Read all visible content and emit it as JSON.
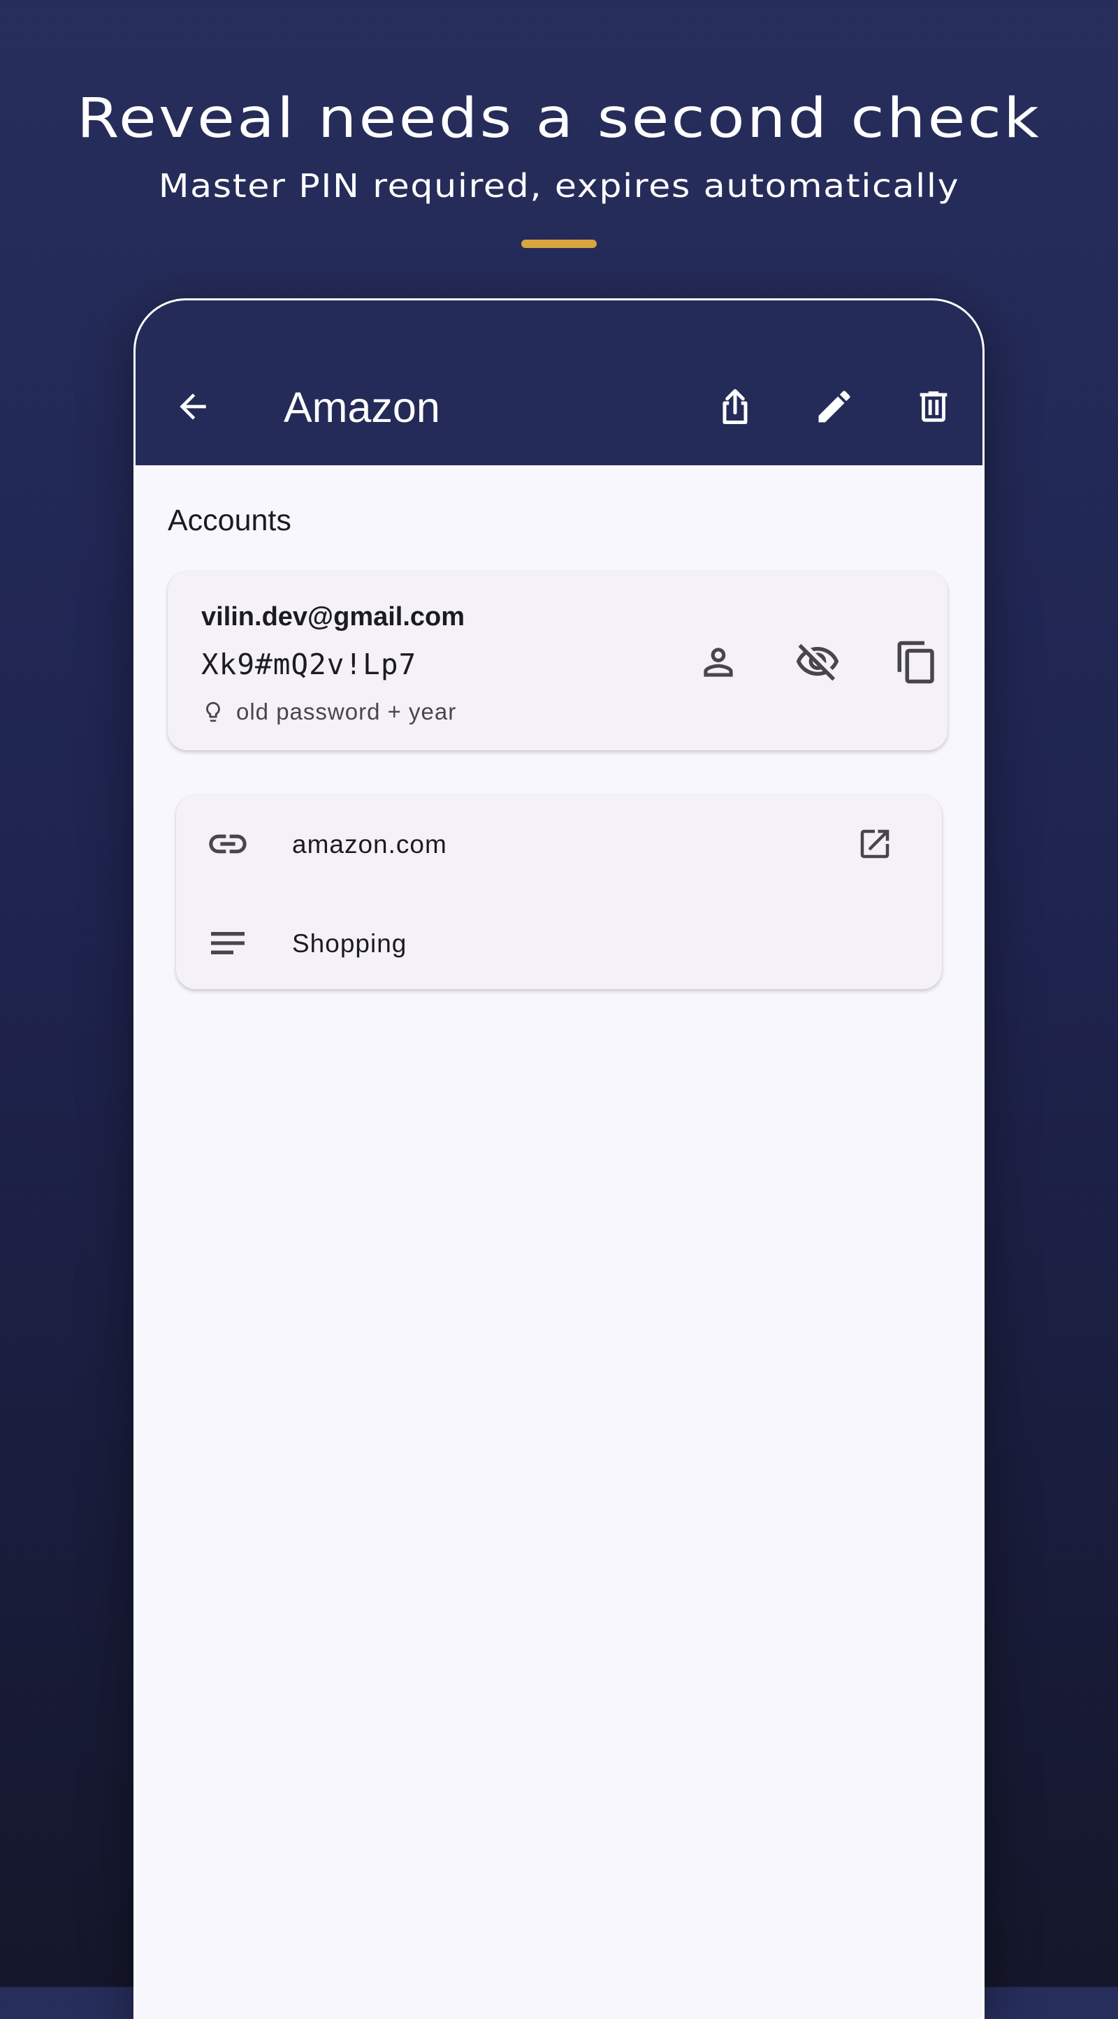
{
  "promo": {
    "title": "Reveal needs a second check",
    "subtitle": "Master PIN required, expires automatically",
    "accent_color": "#d8a53e"
  },
  "app_bar": {
    "title": "Amazon",
    "background_color": "#252b58",
    "back_icon": "arrow-back-icon",
    "actions": [
      "share-icon",
      "edit-icon",
      "delete-icon"
    ]
  },
  "accounts": {
    "heading": "Accounts",
    "items": [
      {
        "username": "vilin.dev@gmail.com",
        "password": "Xk9#mQ2v!Lp7",
        "hint": "old password + year",
        "hint_icon": "lightbulb-icon",
        "actions": [
          "person-icon",
          "visibility-off-icon",
          "copy-icon"
        ]
      }
    ]
  },
  "details": {
    "website": {
      "icon": "link-icon",
      "value": "amazon.com",
      "action_icon": "open-in-new-icon"
    },
    "category": {
      "icon": "notes-icon",
      "value": "Shopping"
    }
  }
}
